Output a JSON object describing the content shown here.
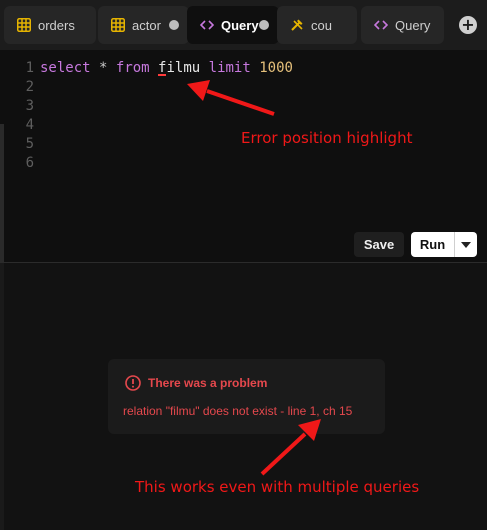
{
  "tabs": [
    {
      "label": "orders",
      "icon": "table-icon",
      "active": false,
      "unsaved": false
    },
    {
      "label": "actor",
      "icon": "table-icon",
      "active": false,
      "unsaved": true
    },
    {
      "label": "Query",
      "icon": "code-icon",
      "active": true,
      "unsaved": true
    },
    {
      "label": "cou",
      "icon": "tools-icon",
      "active": false,
      "unsaved": false
    },
    {
      "label": "Query",
      "icon": "code-icon",
      "active": false,
      "unsaved": false
    }
  ],
  "editor": {
    "line_numbers": [
      "1",
      "2",
      "3",
      "4",
      "5",
      "6"
    ],
    "code": {
      "kw_select": "select",
      "star": "*",
      "kw_from": "from",
      "table_err": "f",
      "table_rest": "ilmu",
      "kw_limit": "limit",
      "limit_value": "1000"
    }
  },
  "toolbar": {
    "save_label": "Save",
    "run_label": "Run"
  },
  "error": {
    "title": "There was a problem",
    "message": "relation \"filmu\" does not exist - line 1, ch 15"
  },
  "annotations": {
    "error_highlight": "Error position highlight",
    "multiple_queries": "This works even with multiple queries"
  },
  "colors": {
    "keyword": "#c678dd",
    "number": "#e5c07b",
    "error": "#e5484d",
    "annotation": "#f01818",
    "table_icon": "#e6b400",
    "code_icon": "#c678dd",
    "tools_icon": "#e6b400"
  }
}
